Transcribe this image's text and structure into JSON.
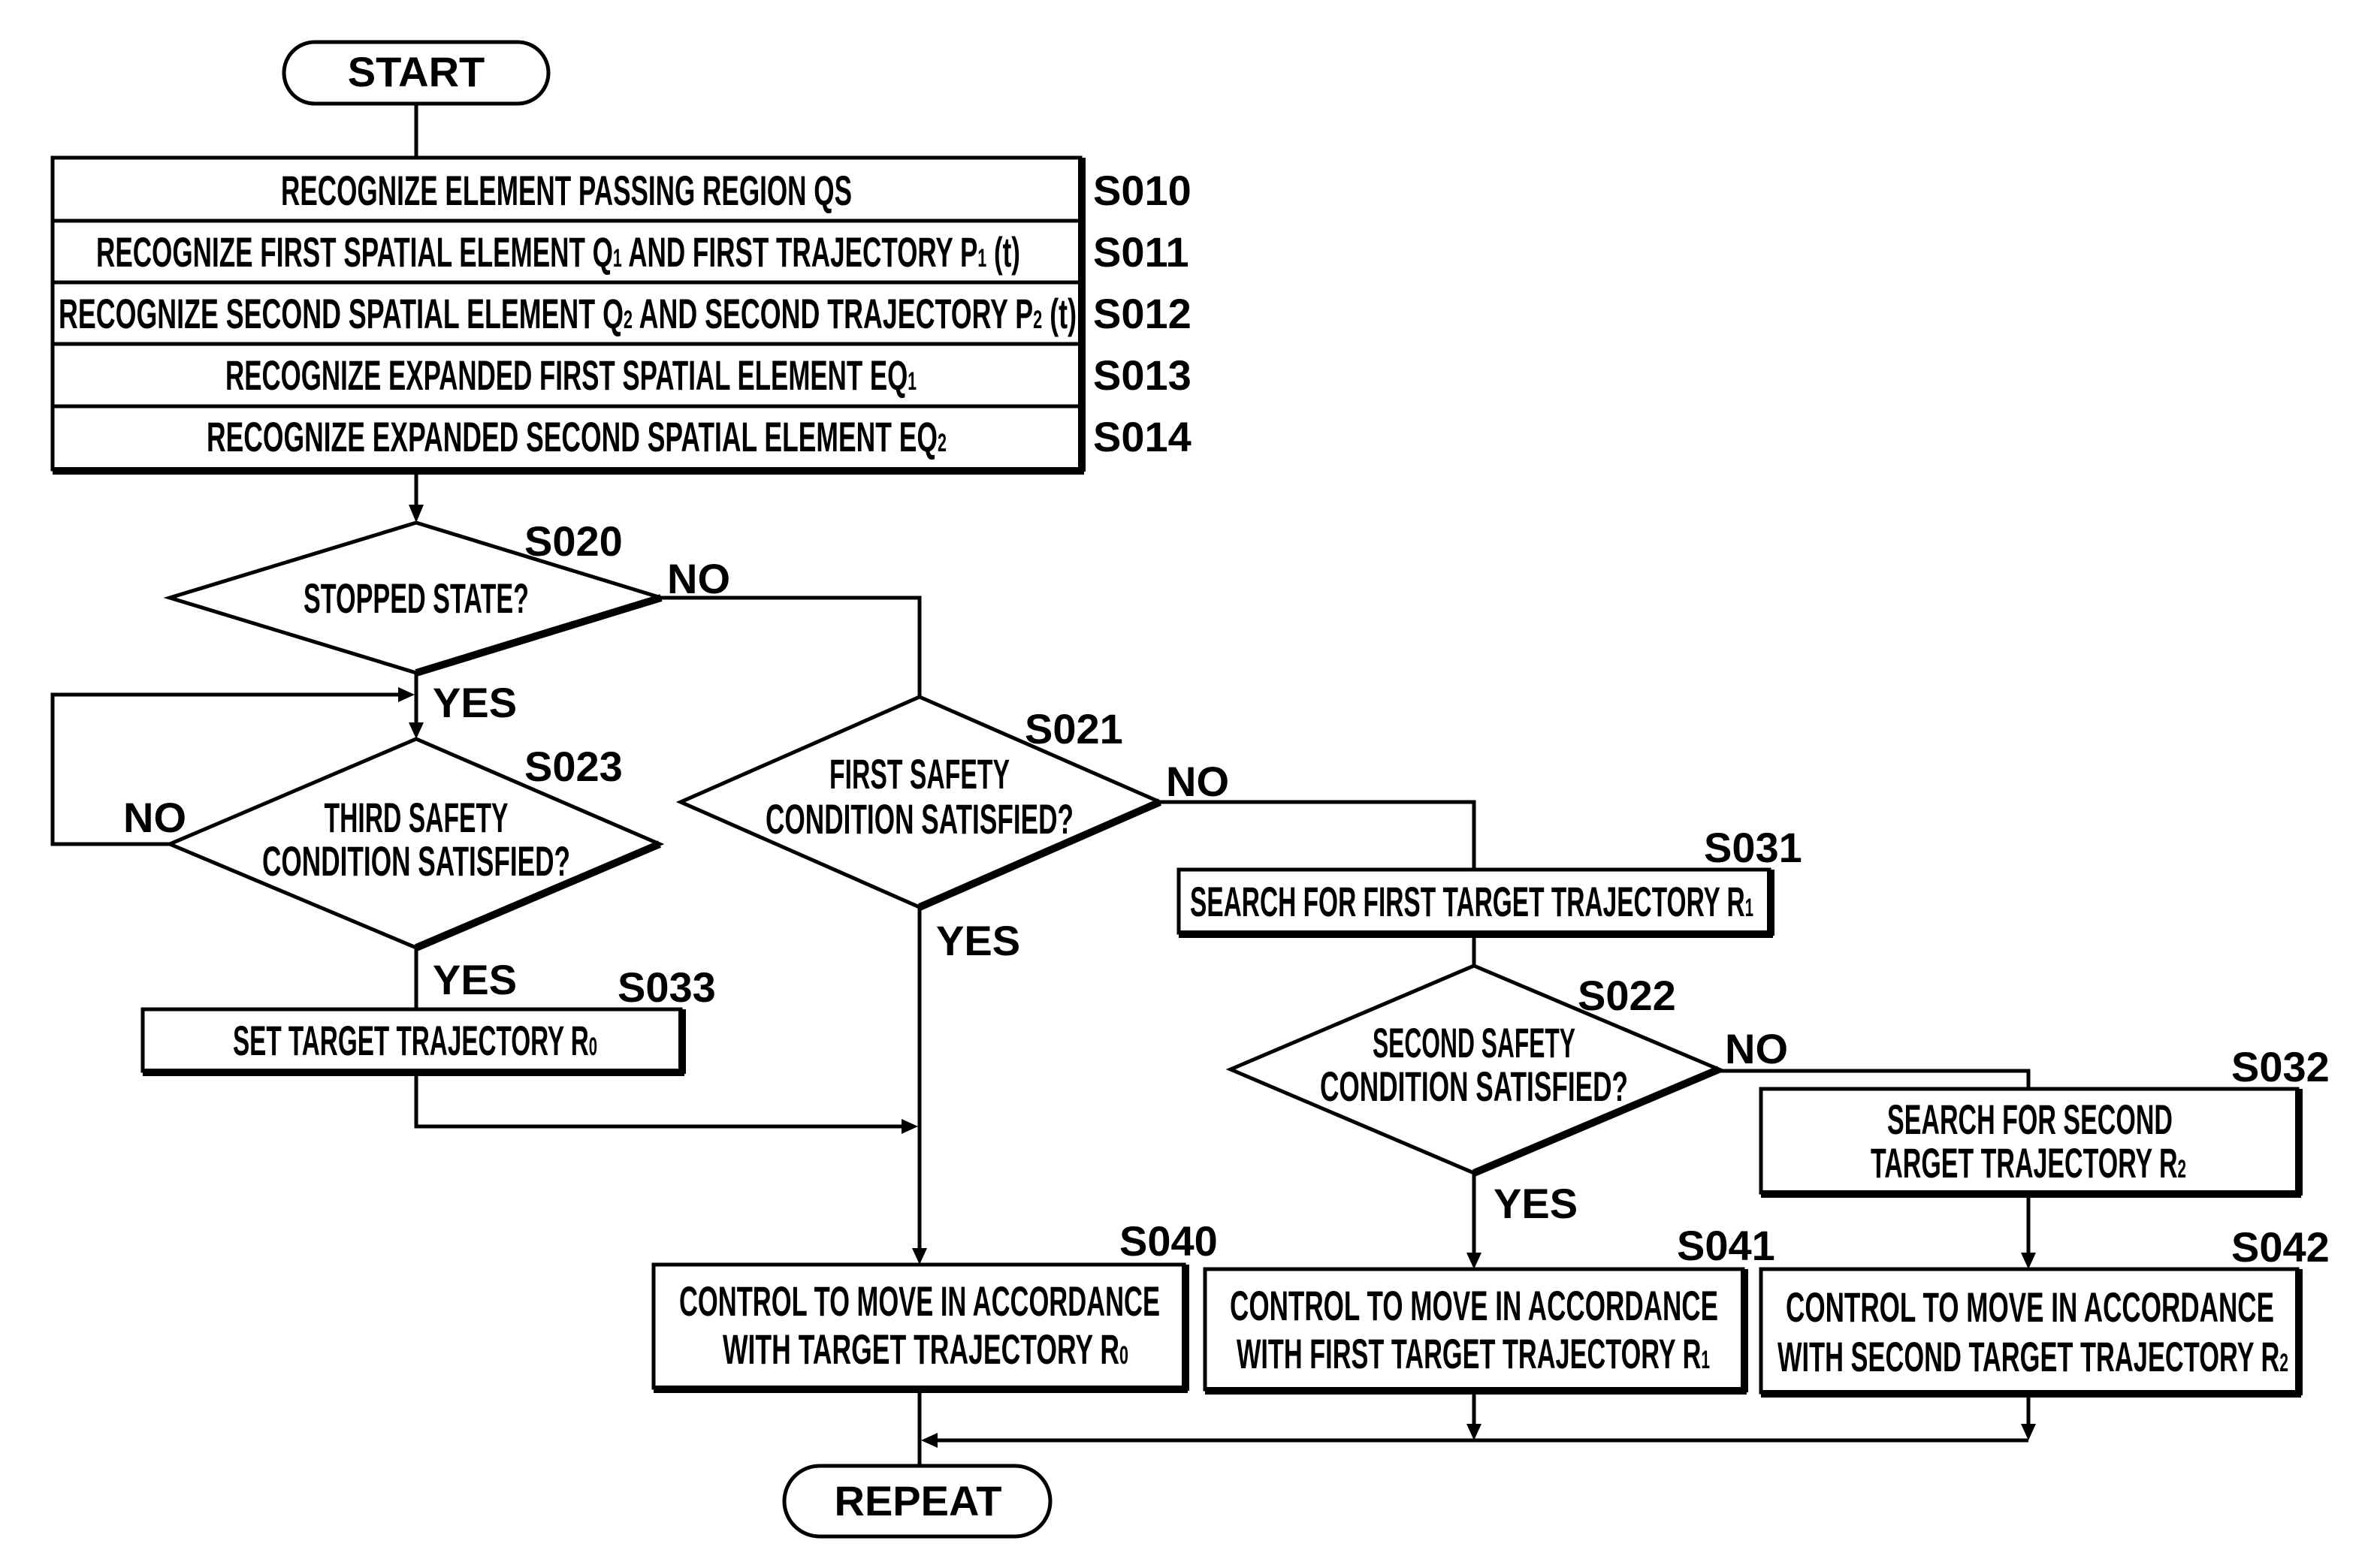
{
  "terminals": {
    "start": "START",
    "repeat": "REPEAT"
  },
  "recognition_block": {
    "rows": [
      {
        "step": "S010",
        "text": "RECOGNIZE ELEMENT PASSING REGION QS",
        "sub": ""
      },
      {
        "step": "S011",
        "text_a": "RECOGNIZE FIRST SPATIAL ELEMENT Q",
        "sub_a": "1",
        "text_b": " AND FIRST TRAJECTORY P",
        "sub_b": "1",
        "text_c": " (t)"
      },
      {
        "step": "S012",
        "text_a": "RECOGNIZE SECOND SPATIAL ELEMENT Q",
        "sub_a": "2",
        "text_b": " AND SECOND TRAJECTORY P",
        "sub_b": "2",
        "text_c": " (t)"
      },
      {
        "step": "S013",
        "text_a": "RECOGNIZE EXPANDED FIRST SPATIAL ELEMENT EQ",
        "sub_a": "1"
      },
      {
        "step": "S014",
        "text_a": "RECOGNIZE EXPANDED SECOND SPATIAL ELEMENT EQ",
        "sub_a": "2"
      }
    ]
  },
  "decisions": {
    "s020": {
      "step": "S020",
      "lines": [
        "STOPPED STATE?"
      ],
      "yes": "YES",
      "no": "NO"
    },
    "s021": {
      "step": "S021",
      "lines": [
        "FIRST SAFETY",
        "CONDITION SATISFIED?"
      ],
      "yes": "YES",
      "no": "NO"
    },
    "s022": {
      "step": "S022",
      "lines": [
        "SECOND SAFETY",
        "CONDITION SATISFIED?"
      ],
      "yes": "YES",
      "no": "NO"
    },
    "s023": {
      "step": "S023",
      "lines": [
        "THIRD SAFETY",
        "CONDITION SATISFIED?"
      ],
      "yes": "YES",
      "no": "NO"
    }
  },
  "processes": {
    "s031": {
      "step": "S031",
      "line1": "SEARCH FOR FIRST TARGET TRAJECTORY R",
      "line1_sub": "1"
    },
    "s032": {
      "step": "S032",
      "line1": "SEARCH FOR SECOND",
      "line2": "TARGET TRAJECTORY R",
      "line2_sub": "2"
    },
    "s033": {
      "step": "S033",
      "line1": "SET TARGET TRAJECTORY R",
      "line1_sub": "0"
    },
    "s040": {
      "step": "S040",
      "line1": "CONTROL TO MOVE IN ACCORDANCE",
      "line2": "WITH TARGET TRAJECTORY R",
      "line2_sub": "0"
    },
    "s041": {
      "step": "S041",
      "line1": "CONTROL TO MOVE IN ACCORDANCE",
      "line2": "WITH FIRST TARGET TRAJECTORY R",
      "line2_sub": "1"
    },
    "s042": {
      "step": "S042",
      "line1": "CONTROL TO MOVE IN ACCORDANCE",
      "line2": "WITH SECOND TARGET TRAJECTORY R",
      "line2_sub": "2"
    }
  }
}
